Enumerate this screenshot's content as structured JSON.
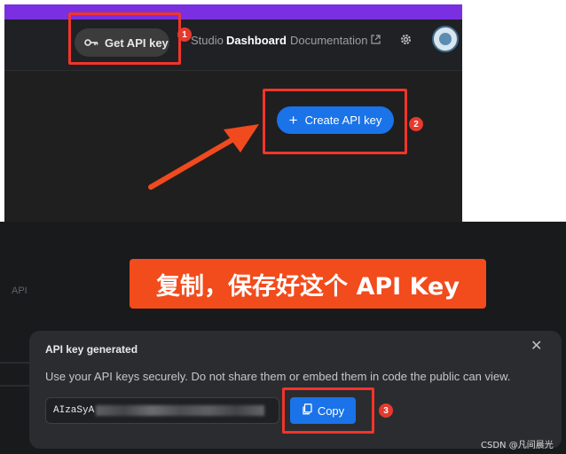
{
  "header": {
    "get_api_key_label": "Get API key",
    "nav_studio": "Studio",
    "nav_dashboard": "Dashboard",
    "nav_documentation": "Documentation"
  },
  "main": {
    "create_api_key_label": "Create API key"
  },
  "background": {
    "api_label": "API"
  },
  "annotation": {
    "banner_text": "复制，保存好这个 API Key",
    "step_1": "1",
    "step_2": "2",
    "step_3": "3",
    "highlight_color": "#f2352a"
  },
  "dialog": {
    "title": "API key generated",
    "description": "Use your API keys securely. Do not share them or embed them in code the public can view.",
    "key_prefix": "AIzaSyA",
    "copy_label": "Copy"
  },
  "watermark": "CSDN @凡间晨光",
  "colors": {
    "accent": "#1a73e8",
    "top_bar": "#7a2fe0",
    "banner": "#f24b1c"
  },
  "icons": {
    "key": "key-icon",
    "external_link": "external-link-icon",
    "settings": "gear-icon",
    "plus": "plus-icon",
    "copy": "copy-icon",
    "close": "close-icon"
  }
}
